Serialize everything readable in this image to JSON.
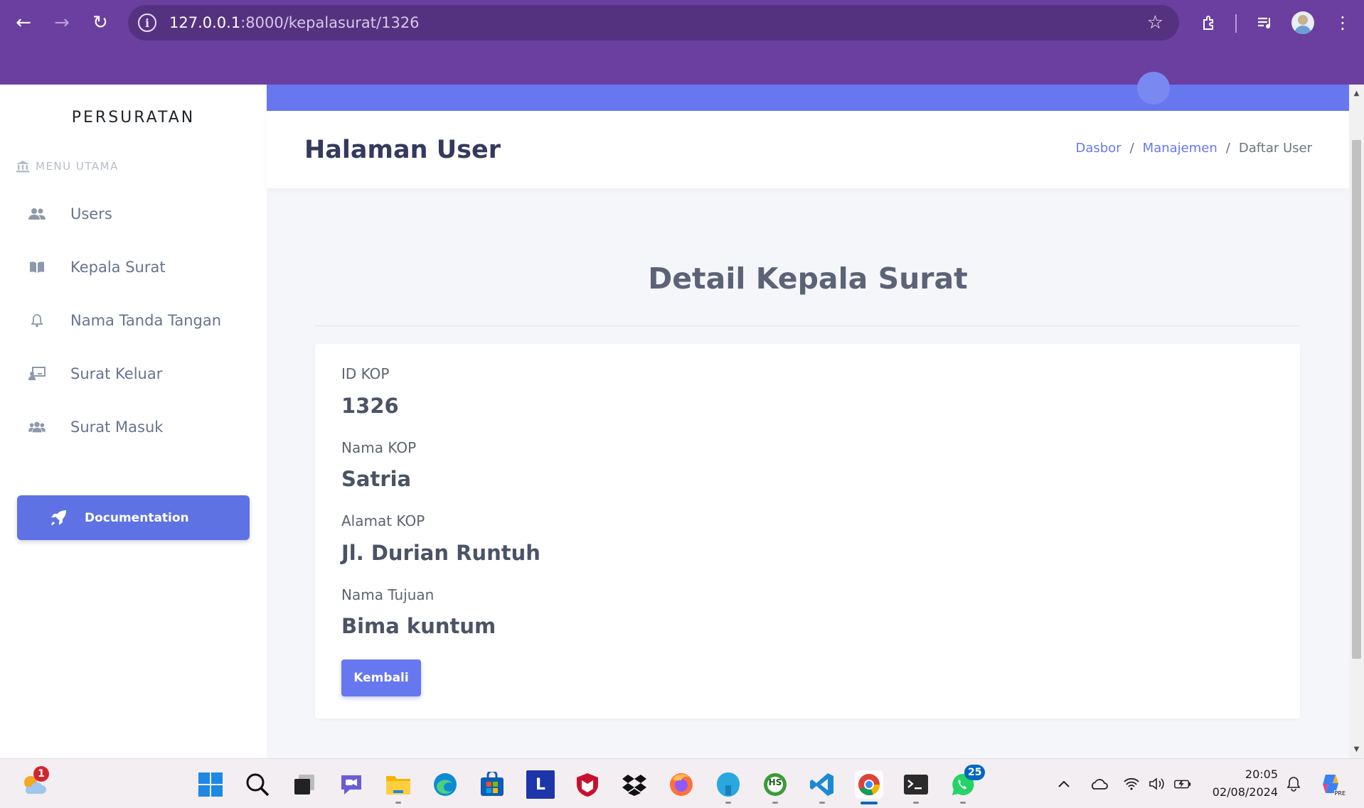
{
  "browser": {
    "url_host": "127.0.0.1",
    "url_path": ":8000/kepalasurat/1326"
  },
  "sidebar": {
    "brand": "PERSURATAN",
    "menu_heading": "MENU UTAMA",
    "items": [
      {
        "label": "Users",
        "icon": "users-icon"
      },
      {
        "label": "Kepala Surat",
        "icon": "book-icon"
      },
      {
        "label": "Nama Tanda Tangan",
        "icon": "bell-icon"
      },
      {
        "label": "Surat Keluar",
        "icon": "chalkboard-user-icon"
      },
      {
        "label": "Surat Masuk",
        "icon": "users-group-icon"
      }
    ],
    "documentation_label": "Documentation"
  },
  "header": {
    "title": "Halaman User",
    "breadcrumb": [
      "Dasbor",
      "Manajemen",
      "Daftar User"
    ]
  },
  "main": {
    "heading": "Detail Kepala Surat",
    "fields": [
      {
        "label": "ID KOP",
        "value": "1326"
      },
      {
        "label": "Nama KOP",
        "value": "Satria"
      },
      {
        "label": "Alamat KOP",
        "value": "Jl. Durian Runtuh"
      },
      {
        "label": "Nama Tujuan",
        "value": "Bima kuntum"
      }
    ],
    "back_button": "Kembali"
  },
  "taskbar": {
    "weather_badge": "1",
    "whatsapp_badge": "25",
    "time": "20:05",
    "date": "02/08/2024",
    "hs_label": "HS",
    "l_label": "L",
    "copilot_label": "PRE"
  },
  "colors": {
    "chrome": "#6b3fa0",
    "accent": "#6777ef",
    "doc_button": "#5e72e4"
  }
}
